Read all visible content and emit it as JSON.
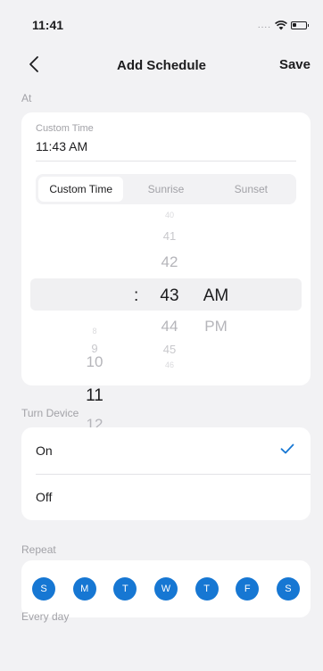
{
  "status": {
    "time": "11:41",
    "dots": "....",
    "wifi": "wifi-icon",
    "battery": "battery-icon"
  },
  "nav": {
    "title": "Add Schedule",
    "save": "Save",
    "back_icon": "chevron-left-icon"
  },
  "at": {
    "label": "At",
    "custom_caption": "Custom Time",
    "custom_value": "11:43 AM",
    "tabs": [
      {
        "label": "Custom Time",
        "active": true
      },
      {
        "label": "Sunrise",
        "active": false
      },
      {
        "label": "Sunset",
        "active": false
      }
    ],
    "picker": {
      "hours": [
        "8",
        "9",
        "10",
        "11",
        "12"
      ],
      "colon": ":",
      "minutes": [
        "40",
        "41",
        "42",
        "43",
        "44",
        "45",
        "46"
      ],
      "periods": [
        "AM",
        "PM"
      ],
      "selected": {
        "hour": "11",
        "minute": "43",
        "period": "AM"
      }
    }
  },
  "turn_device": {
    "label": "Turn Device",
    "options": [
      {
        "label": "On",
        "selected": true
      },
      {
        "label": "Off",
        "selected": false
      }
    ],
    "check_icon": "checkmark-icon"
  },
  "repeat": {
    "label": "Repeat",
    "days": [
      "S",
      "M",
      "T",
      "W",
      "T",
      "F",
      "S"
    ],
    "all_selected": true,
    "summary": "Every day"
  },
  "colors": {
    "accent": "#1677d3",
    "background": "#f2f2f4",
    "card": "#ffffff",
    "secondary_text": "#a2a2a7"
  }
}
